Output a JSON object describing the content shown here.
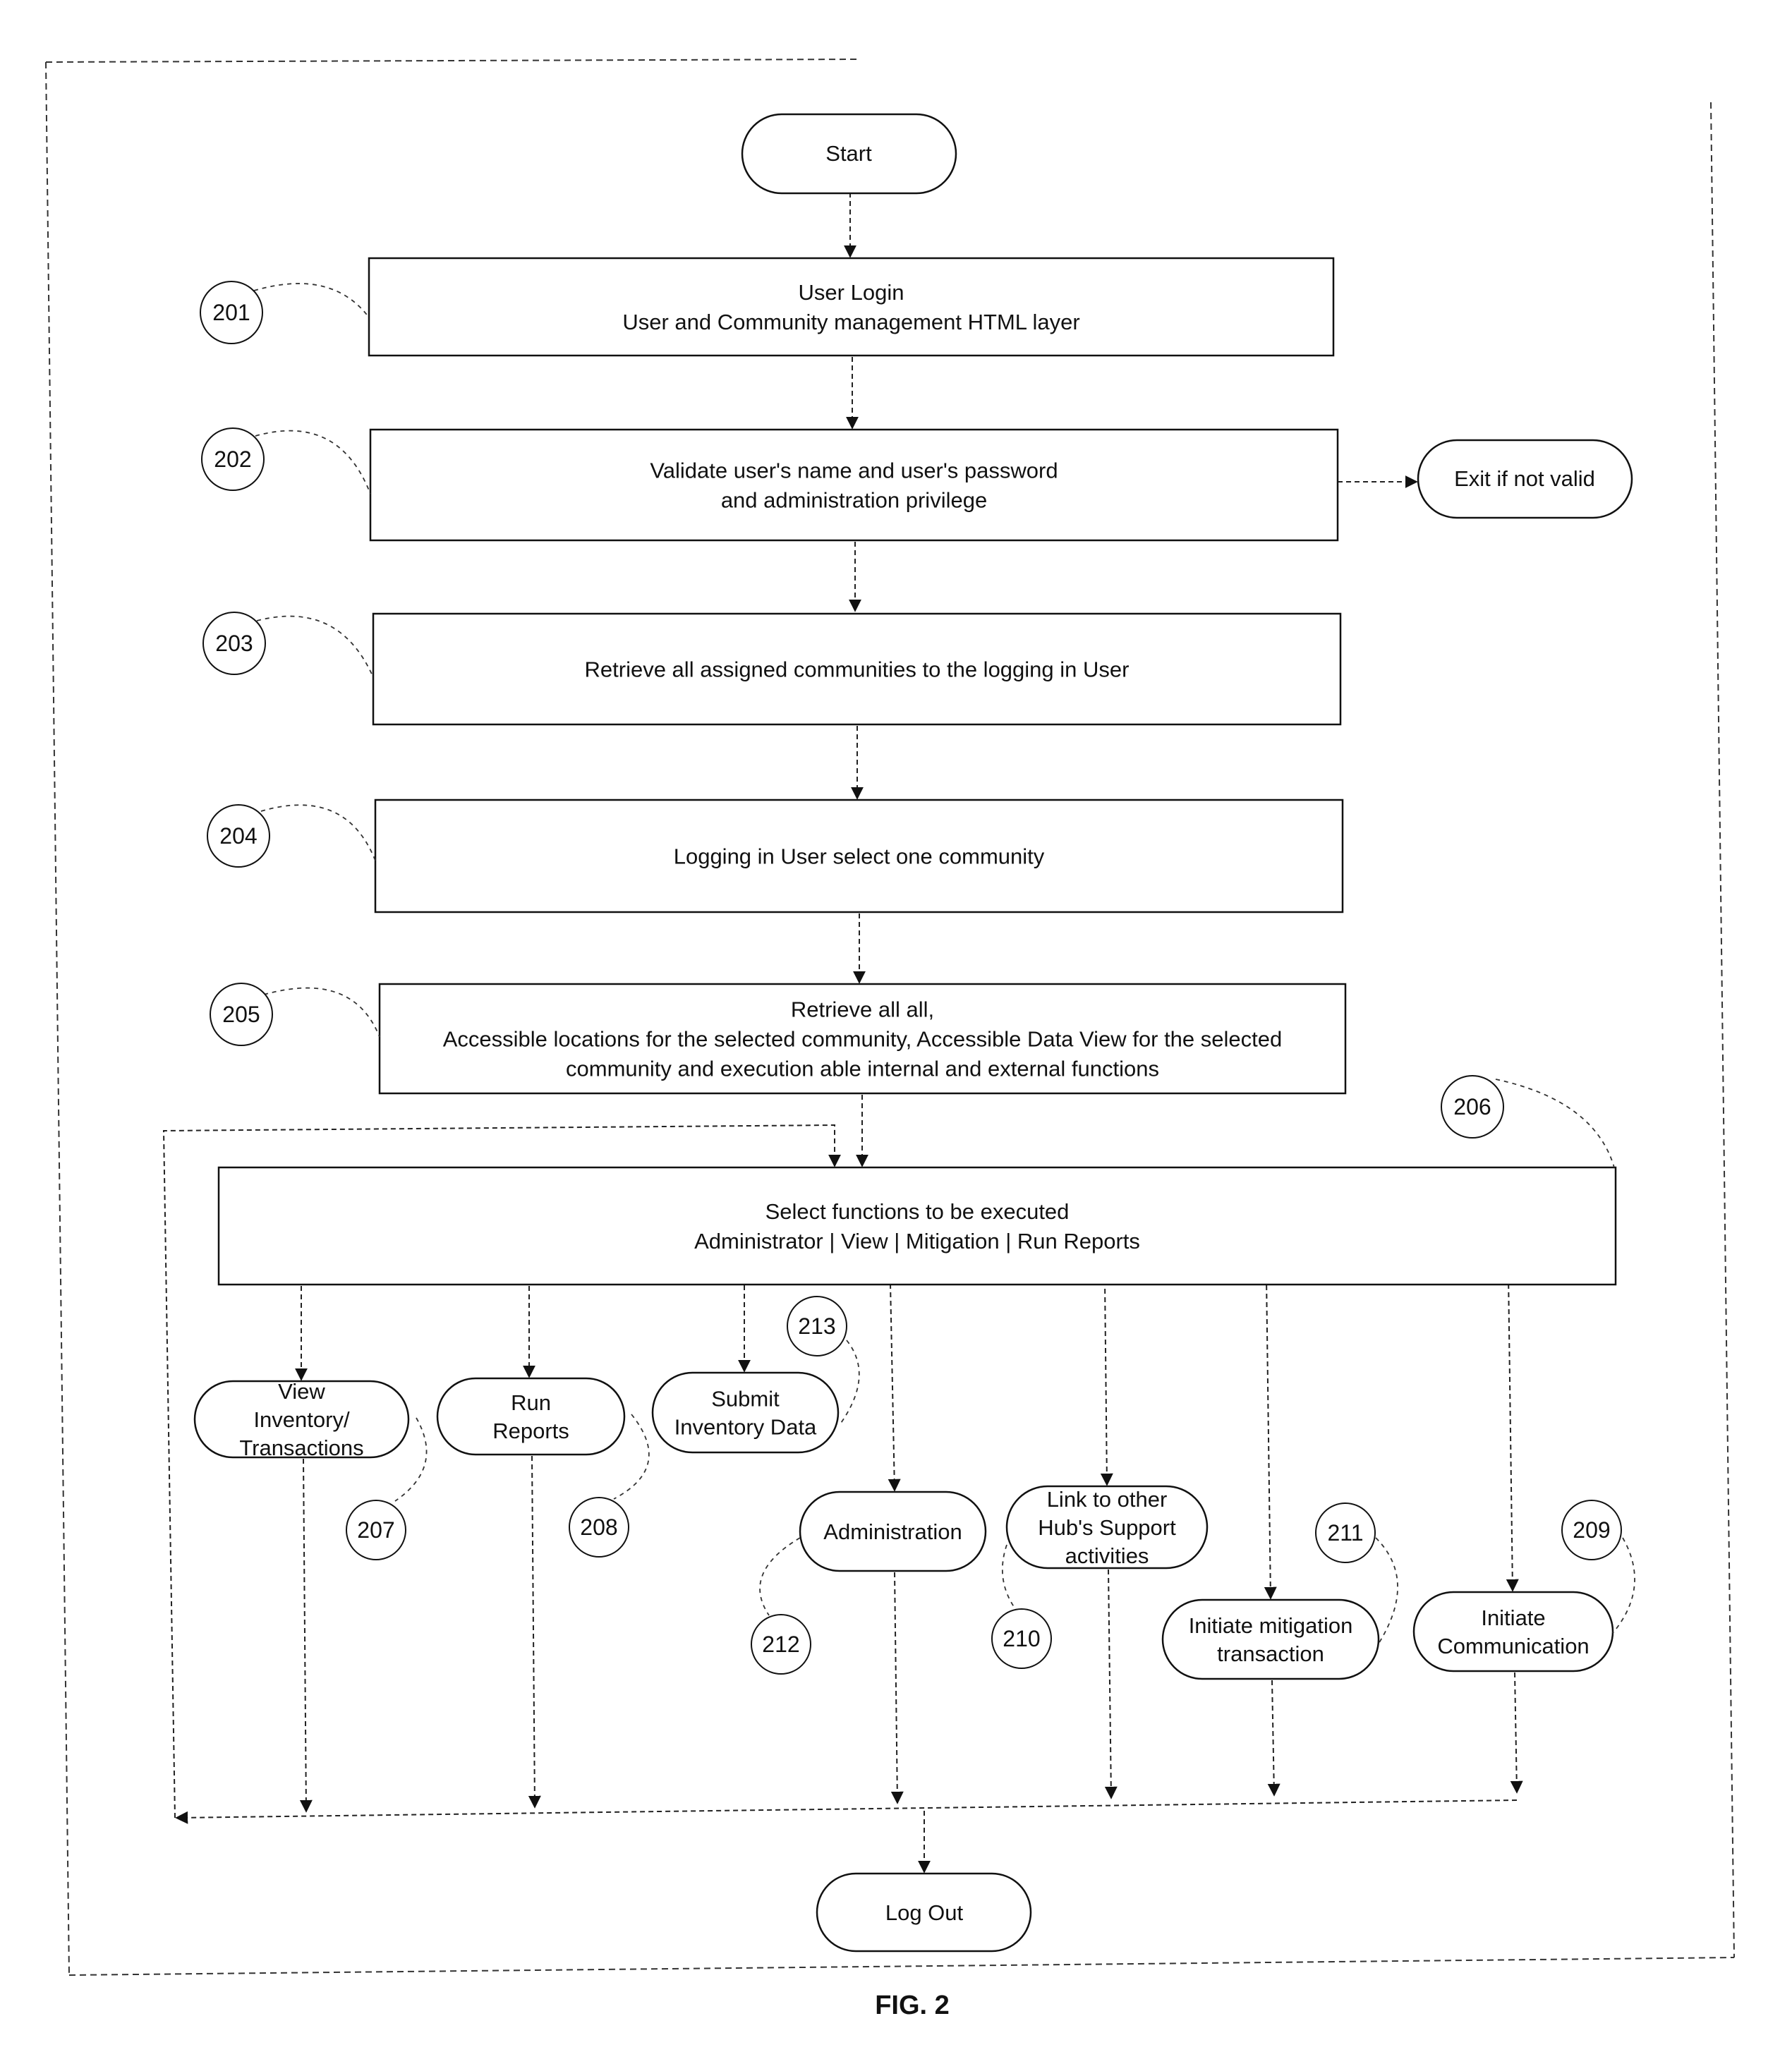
{
  "figure": {
    "caption": "FIG. 2"
  },
  "terminals": {
    "start": "Start",
    "exit": "Exit if not valid",
    "logout": "Log Out"
  },
  "steps": [
    {
      "ref": "201",
      "lines": [
        "User Login",
        "User and Community management HTML layer"
      ]
    },
    {
      "ref": "202",
      "lines": [
        "Validate user's name and user's password",
        "and administration privilege"
      ]
    },
    {
      "ref": "203",
      "lines": [
        "Retrieve all assigned communities to the logging in User"
      ]
    },
    {
      "ref": "204",
      "lines": [
        "Logging in User select one community"
      ]
    },
    {
      "ref": "205",
      "lines": [
        "Retrieve all all,",
        "Accessible locations for the selected  community, Accessible Data View  for the selected",
        "community and execution able internal and external functions"
      ]
    },
    {
      "ref": "206",
      "lines": [
        "Select functions to be executed",
        "Administrator | View  | Mitigation | Run Reports"
      ]
    }
  ],
  "functions": [
    {
      "ref": "207",
      "lines": [
        "View",
        "Inventory/",
        "Transactions"
      ]
    },
    {
      "ref": "208",
      "lines": [
        "Run",
        "Reports"
      ]
    },
    {
      "ref": "213",
      "lines": [
        "Submit",
        "Inventory Data"
      ]
    },
    {
      "ref": "212",
      "lines": [
        "Administration"
      ]
    },
    {
      "ref": "210",
      "lines": [
        "Link to other",
        "Hub's Support",
        "activities"
      ]
    },
    {
      "ref": "211",
      "lines": [
        "Initiate mitigation",
        "transaction"
      ]
    },
    {
      "ref": "209",
      "lines": [
        "Initiate",
        "Communication"
      ]
    }
  ]
}
